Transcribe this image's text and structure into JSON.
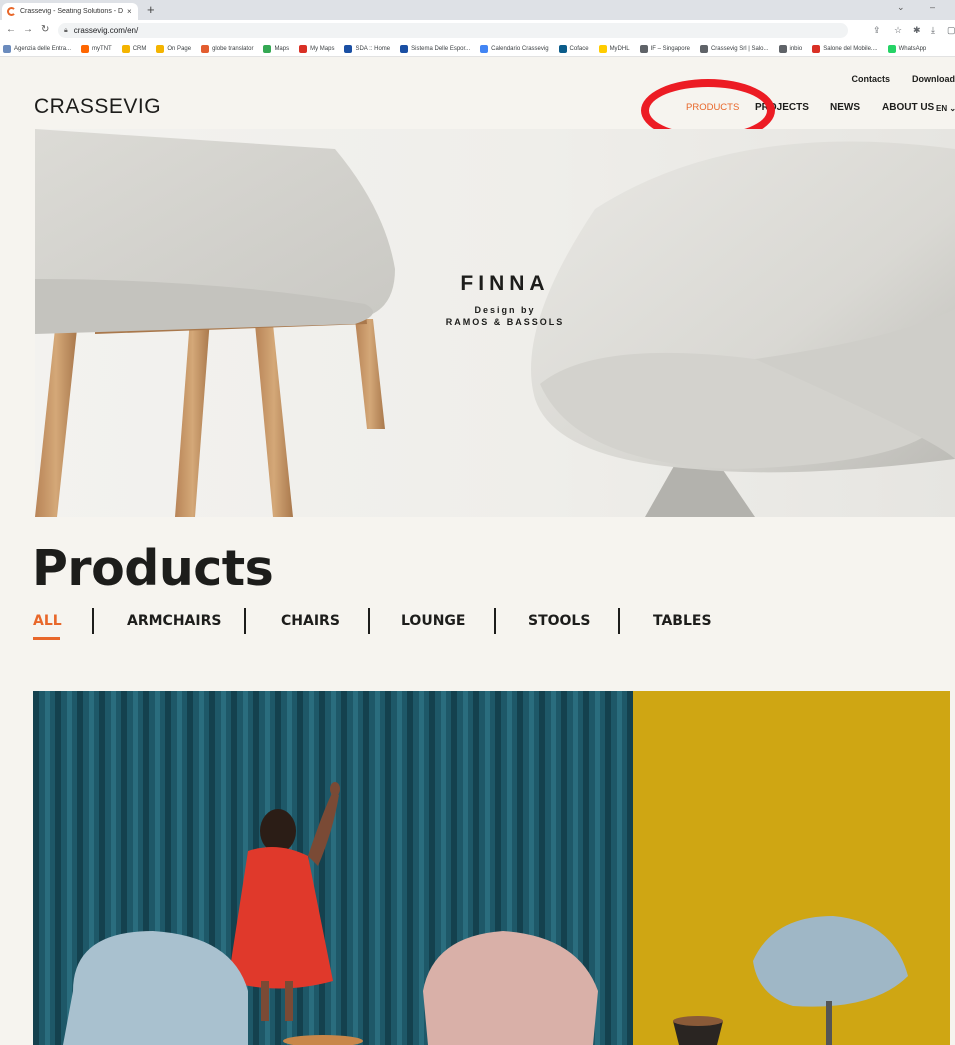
{
  "browser": {
    "tab_title": "Crassevig - Seating Solutions - D",
    "tab_close": "×",
    "new_tab": "+",
    "url": "crassevig.com/en/",
    "bookmarks": [
      {
        "label": "Agenzia delle Entra...",
        "color": "#6b8bbd"
      },
      {
        "label": "myTNT",
        "color": "#ff6600"
      },
      {
        "label": "CRM",
        "color": "#f4b400"
      },
      {
        "label": "On Page",
        "color": "#f4b400"
      },
      {
        "label": "globe translator",
        "color": "#e35d2f"
      },
      {
        "label": "Maps",
        "color": "#34a853"
      },
      {
        "label": "My Maps",
        "color": "#d93025"
      },
      {
        "label": "SDA :: Home",
        "color": "#1a4fa3"
      },
      {
        "label": "Sistema Delle Espor...",
        "color": "#1a4fa3"
      },
      {
        "label": "Calendario Crassevig",
        "color": "#4285f4"
      },
      {
        "label": "Coface",
        "color": "#0b5c8a"
      },
      {
        "label": "MyDHL",
        "color": "#ffcc00"
      },
      {
        "label": "IF – Singapore",
        "color": "#5f6368"
      },
      {
        "label": "Crassevig Srl | Salo...",
        "color": "#5f6368"
      },
      {
        "label": "inbio",
        "color": "#5f6368"
      },
      {
        "label": "Salone del Mobile....",
        "color": "#d93025"
      },
      {
        "label": "WhatsApp",
        "color": "#25d366"
      }
    ]
  },
  "site": {
    "toplinks": [
      "Contacts",
      "Download"
    ],
    "logo": "CRASSEVIG",
    "nav": {
      "products": "PRODUCTS",
      "projects": "PROJECTS",
      "news": "NEWS",
      "about": "ABOUT US",
      "lang": "EN ⌄"
    },
    "accent_color": "#e8672a",
    "annotation_color": "#ec1c24"
  },
  "hero": {
    "title": "FINNA",
    "design_by": "Design by",
    "designer": "RAMOS & BASSOLS"
  },
  "products": {
    "heading": "Products",
    "filters": [
      "ALL",
      "ARMCHAIRS",
      "CHAIRS",
      "LOUNGE",
      "STOOLS",
      "TABLES"
    ],
    "active_filter": "ALL"
  }
}
